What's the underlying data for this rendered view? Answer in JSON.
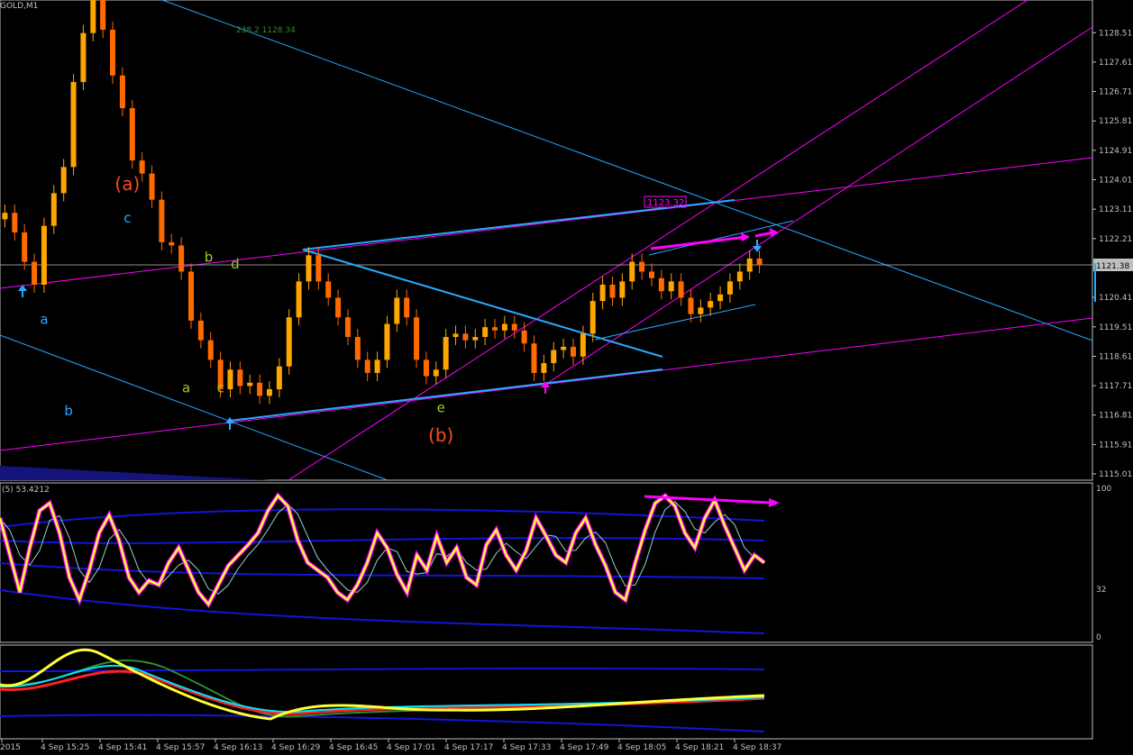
{
  "window": {
    "symbol_label": "GOLD,M1"
  },
  "price_panel": {
    "fib_label": "238.2 1128.34",
    "box_label": "1123.32",
    "current_price": "1121.38",
    "y_ticks": [
      {
        "v": 1128.51,
        "t": "1128.51"
      },
      {
        "v": 1127.61,
        "t": "1127.61"
      },
      {
        "v": 1126.71,
        "t": "1126.71"
      },
      {
        "v": 1125.81,
        "t": "1125.81"
      },
      {
        "v": 1124.91,
        "t": "1124.91"
      },
      {
        "v": 1124.01,
        "t": "1124.01"
      },
      {
        "v": 1123.11,
        "t": "1123.11"
      },
      {
        "v": 1122.21,
        "t": "1122.21"
      },
      {
        "v": 1120.41,
        "t": "1120.41"
      },
      {
        "v": 1119.51,
        "t": "1119.51"
      },
      {
        "v": 1118.61,
        "t": "1118.61"
      },
      {
        "v": 1117.71,
        "t": "1117.71"
      },
      {
        "v": 1116.81,
        "t": "1116.81"
      },
      {
        "v": 1115.91,
        "t": "1115.91"
      },
      {
        "v": 1115.01,
        "t": "1115.01"
      }
    ],
    "ylim": [
      1114.9,
      1129.4
    ],
    "wave_labels": [
      {
        "text": "(a)",
        "color": "#ff4a1a",
        "x": 12.5,
        "y": 1123.7
      },
      {
        "text": "(b)",
        "color": "#ff4a1a",
        "x": 44.5,
        "y": 1116.0
      },
      {
        "text": "c",
        "color": "#29a9ff",
        "x": 12.5,
        "y": 1122.7
      },
      {
        "text": "a",
        "color": "#29a9ff",
        "x": 4.0,
        "y": 1119.6
      },
      {
        "text": "b",
        "color": "#29a9ff",
        "x": 6.5,
        "y": 1116.8
      },
      {
        "text": "b",
        "color": "#9acd32",
        "x": 20.8,
        "y": 1121.5
      },
      {
        "text": "d",
        "color": "#9acd32",
        "x": 23.5,
        "y": 1121.3
      },
      {
        "text": "a",
        "color": "#9acd32",
        "x": 18.5,
        "y": 1117.5
      },
      {
        "text": "c",
        "color": "#9acd32",
        "x": 22.0,
        "y": 1117.5
      },
      {
        "text": "e",
        "color": "#9acd32",
        "x": 44.5,
        "y": 1116.9
      }
    ],
    "close_series": [
      1123.0,
      1122.4,
      1121.5,
      1120.8,
      1122.6,
      1123.6,
      1124.4,
      1127.0,
      1128.5,
      1129.6,
      1128.6,
      1127.2,
      1126.2,
      1124.6,
      1124.2,
      1123.4,
      1122.1,
      1122.0,
      1121.2,
      1119.7,
      1119.1,
      1118.5,
      1117.6,
      1118.2,
      1117.7,
      1117.8,
      1117.4,
      1117.6,
      1118.3,
      1119.8,
      1120.9,
      1121.7,
      1120.9,
      1120.4,
      1119.8,
      1119.2,
      1118.5,
      1118.1,
      1118.5,
      1119.6,
      1120.4,
      1119.8,
      1118.5,
      1118.0,
      1118.2,
      1119.2,
      1119.3,
      1119.1,
      1119.2,
      1119.5,
      1119.4,
      1119.6,
      1119.4,
      1119.0,
      1118.1,
      1118.4,
      1118.8,
      1118.9,
      1118.6,
      1119.3,
      1120.3,
      1120.8,
      1120.4,
      1120.9,
      1121.5,
      1121.2,
      1121.0,
      1120.6,
      1120.9,
      1120.4,
      1119.9,
      1120.1,
      1120.3,
      1120.5,
      1120.9,
      1121.2,
      1121.6,
      1121.4
    ],
    "x_ticks": [
      "2015",
      "4 Sep 15:25",
      "4 Sep 15:41",
      "4 Sep 15:57",
      "4 Sep 16:13",
      "4 Sep 16:29",
      "4 Sep 16:45",
      "4 Sep 17:01",
      "4 Sep 17:17",
      "4 Sep 17:33",
      "4 Sep 17:49",
      "4 Sep 18:05",
      "4 Sep 18:21",
      "4 Sep 18:37"
    ]
  },
  "stoch_panel": {
    "title": "(5) 53.4212",
    "ticks": [
      {
        "v": 100,
        "t": "100"
      },
      {
        "v": 32,
        "t": "32"
      },
      {
        "v": 0,
        "t": "0"
      }
    ],
    "main_series": [
      80,
      55,
      30,
      60,
      85,
      90,
      70,
      40,
      25,
      45,
      70,
      82,
      65,
      40,
      30,
      38,
      35,
      50,
      60,
      45,
      30,
      22,
      35,
      48,
      55,
      62,
      70,
      85,
      95,
      88,
      65,
      50,
      45,
      40,
      30,
      25,
      35,
      50,
      70,
      60,
      42,
      30,
      55,
      45,
      68,
      50,
      60,
      40,
      35,
      62,
      72,
      55,
      45,
      58,
      80,
      68,
      55,
      50,
      70,
      80,
      62,
      48,
      30,
      25,
      50,
      72,
      90,
      95,
      88,
      70,
      60,
      80,
      92,
      75,
      60,
      45,
      55,
      50
    ]
  },
  "colors": {
    "axis": "#c0c0c0",
    "bull_candle": "#ffa500",
    "bear_candle": "#ff6a00",
    "trendline": "#29a9ff",
    "channel_magenta": "#ff00ff",
    "stoch_main": "#ffff33",
    "stoch_outline": "#ff00ff",
    "bands": "#1414d9"
  },
  "chart_data": {
    "type": "line",
    "title": "GOLD,M1",
    "x": [
      "2015",
      "4 Sep 15:25",
      "4 Sep 15:41",
      "4 Sep 15:57",
      "4 Sep 16:13",
      "4 Sep 16:29",
      "4 Sep 16:45",
      "4 Sep 17:01",
      "4 Sep 17:17",
      "4 Sep 17:33",
      "4 Sep 17:49",
      "4 Sep 18:05",
      "4 Sep 18:21",
      "4 Sep 18:37"
    ],
    "series": [
      {
        "values": [
          1123.0,
          1128.4,
          1124.2,
          1120.0,
          1117.6,
          1121.7,
          1118.5,
          1119.8,
          1119.5,
          1118.1,
          1120.6,
          1121.2,
          1119.9,
          1121.4
        ]
      }
    ],
    "ylim": [
      1114.9,
      1129.4
    ],
    "xlabel": "",
    "ylabel": "",
    "grid": false
  }
}
